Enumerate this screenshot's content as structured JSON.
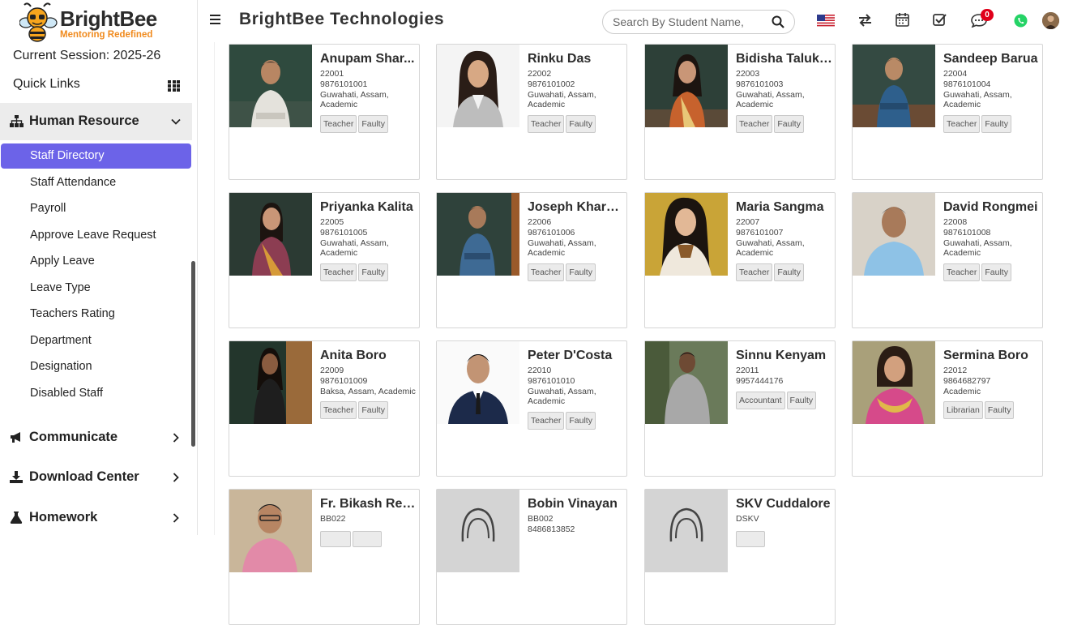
{
  "brand": {
    "name": "BrightBee",
    "tagline": "Mentoring Redefined",
    "company": "BrightBee Technologies"
  },
  "session": "Current Session: 2025-26",
  "quick_links": "Quick Links",
  "sidebar": {
    "section": "Human Resource",
    "active": "Staff Directory",
    "items": [
      "Staff Attendance",
      "Payroll",
      "Approve Leave Request",
      "Apply Leave",
      "Leave Type",
      "Teachers Rating",
      "Department",
      "Designation",
      "Disabled Staff"
    ],
    "sections": [
      "Communicate",
      "Download Center",
      "Homework"
    ]
  },
  "search": {
    "placeholder": "Search By Student Name,"
  },
  "header": {
    "notification_count": "0"
  },
  "colors": {
    "accent": "#6c63e8",
    "badge": "#e0001a",
    "brand_orange": "#f08a1d"
  },
  "staff": [
    {
      "name": "Anupam Shar...",
      "id": "22001",
      "phone": "9876101001",
      "location": "Guwahati, Assam, Academic",
      "tags": [
        "Teacher",
        "Faulty"
      ]
    },
    {
      "name": "Rinku Das",
      "id": "22002",
      "phone": "9876101002",
      "location": "Guwahati, Assam, Academic",
      "tags": [
        "Teacher",
        "Faulty"
      ]
    },
    {
      "name": "Bidisha Talukd...",
      "id": "22003",
      "phone": "9876101003",
      "location": "Guwahati, Assam, Academic",
      "tags": [
        "Teacher",
        "Faulty"
      ]
    },
    {
      "name": "Sandeep Barua",
      "id": "22004",
      "phone": "9876101004",
      "location": "Guwahati, Assam, Academic",
      "tags": [
        "Teacher",
        "Faulty"
      ]
    },
    {
      "name": "Priyanka Kalita",
      "id": "22005",
      "phone": "9876101005",
      "location": "Guwahati, Assam, Academic",
      "tags": [
        "Teacher",
        "Faulty"
      ]
    },
    {
      "name": "Joseph Kharm...",
      "id": "22006",
      "phone": "9876101006",
      "location": "Guwahati, Assam, Academic",
      "tags": [
        "Teacher",
        "Faulty"
      ]
    },
    {
      "name": "Maria Sangma",
      "id": "22007",
      "phone": "9876101007",
      "location": "Guwahati, Assam, Academic",
      "tags": [
        "Teacher",
        "Faulty"
      ]
    },
    {
      "name": "David Rongmei",
      "id": "22008",
      "phone": "9876101008",
      "location": "Guwahati, Assam, Academic",
      "tags": [
        "Teacher",
        "Faulty"
      ]
    },
    {
      "name": "Anita Boro",
      "id": "22009",
      "phone": "9876101009",
      "location": "Baksa, Assam, Academic",
      "tags": [
        "Teacher",
        "Faulty"
      ]
    },
    {
      "name": "Peter D'Costa",
      "id": "22010",
      "phone": "9876101010",
      "location": "Guwahati, Assam, Academic",
      "tags": [
        "Teacher",
        "Faulty"
      ]
    },
    {
      "name": "Sinnu Kenyam",
      "id": "22011",
      "phone": "9957444176",
      "location": "",
      "tags": [
        "Accountant",
        "Faulty"
      ]
    },
    {
      "name": "Sermina Boro",
      "id": "22012",
      "phone": "9864682797",
      "location": "Academic",
      "tags": [
        "Librarian",
        "Faulty"
      ]
    },
    {
      "name": "Fr. Bikash Rev...",
      "id": "BB022",
      "phone": "",
      "location": "",
      "tags": [
        "",
        ""
      ]
    },
    {
      "name": "Bobin Vinayan",
      "id": "BB002",
      "phone": "8486813852",
      "location": "",
      "tags": []
    },
    {
      "name": "SKV Cuddalore",
      "id": "DSKV",
      "phone": "",
      "location": "",
      "tags": [
        ""
      ]
    }
  ]
}
